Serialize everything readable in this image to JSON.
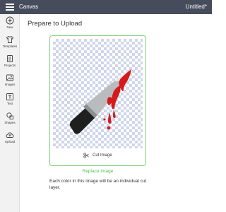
{
  "header": {
    "app_title": "Canvas",
    "doc_title": "Untitled*",
    "background": "#474c5d"
  },
  "sidebar": {
    "items": [
      {
        "label": "New",
        "icon": "plus-circle-icon"
      },
      {
        "label": "Templates",
        "icon": "shirt-icon"
      },
      {
        "label": "Projects",
        "icon": "projects-icon"
      },
      {
        "label": "Images",
        "icon": "image-icon"
      },
      {
        "label": "Text",
        "icon": "text-icon"
      },
      {
        "label": "Shapes",
        "icon": "shapes-icon"
      },
      {
        "label": "Upload",
        "icon": "upload-cloud-icon"
      }
    ]
  },
  "main": {
    "title": "Prepare to Upload",
    "cut_label": "Cut Image",
    "replace_label": "Replace Image",
    "info_text": "Each color in this image will be an individual cut layer.",
    "accent": "#4fbf4a",
    "card_border": "#7ed07a"
  }
}
